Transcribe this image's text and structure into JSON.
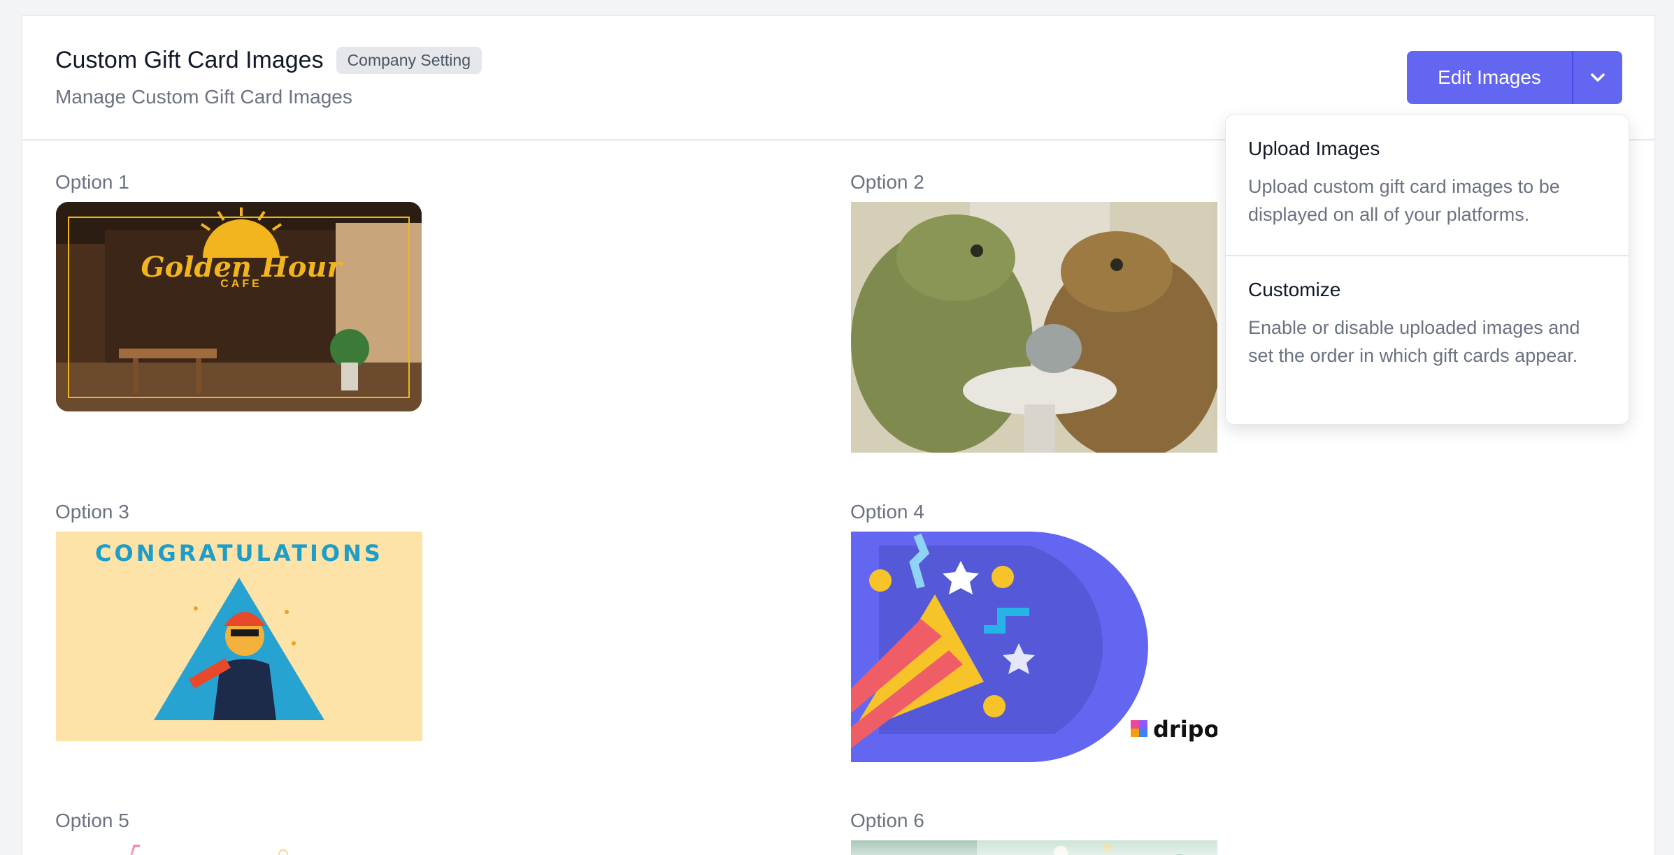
{
  "header": {
    "title": "Custom Gift Card Images",
    "badge": "Company Setting",
    "subtitle": "Manage Custom Gift Card Images",
    "edit_button": "Edit Images"
  },
  "options": [
    {
      "label": "Option 1",
      "image_text": "Golden Hour",
      "image_subtext": "CAFE"
    },
    {
      "label": "Option 2"
    },
    {
      "label": "Option 3",
      "image_text": "CONGRATULATIONS"
    },
    {
      "label": "Option 4",
      "brand": "dripos"
    },
    {
      "label": "Option 5"
    },
    {
      "label": "Option 6"
    }
  ],
  "dropdown": {
    "items": [
      {
        "title": "Upload Images",
        "description": "Upload custom gift card images to be displayed on all of your platforms."
      },
      {
        "title": "Customize",
        "description": "Enable or disable uploaded images and set the order in which gift cards appear."
      }
    ]
  },
  "colors": {
    "accent": "#6366f1",
    "page_bg": "#f3f4f6",
    "muted_text": "#6b7280"
  }
}
